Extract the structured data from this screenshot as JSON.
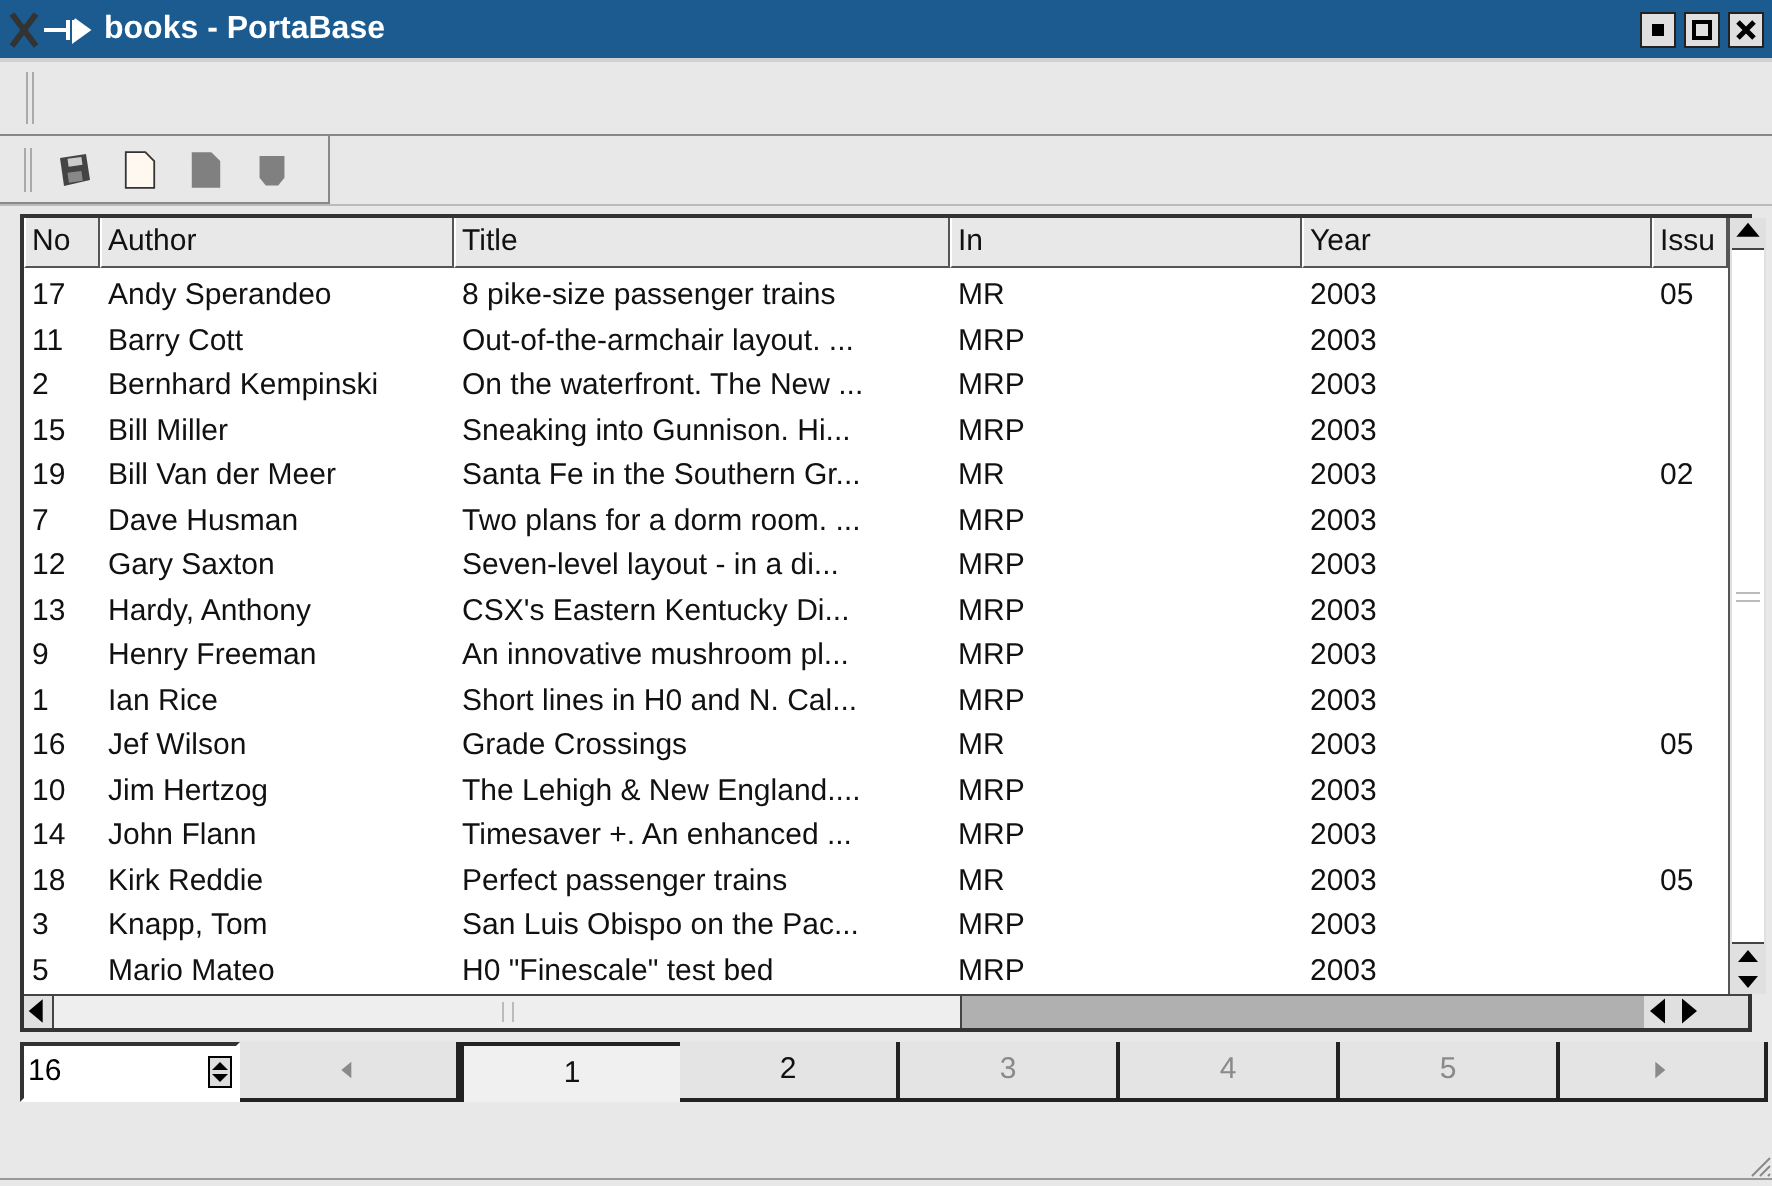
{
  "window": {
    "title": "books - PortaBase"
  },
  "table": {
    "columns": [
      "No",
      "Author",
      "Title",
      "In",
      "Year",
      "Issu"
    ],
    "rows": [
      [
        "17",
        "Andy Sperandeo",
        "8 pike-size passenger trains",
        "MR",
        "2003",
        "05"
      ],
      [
        "11",
        "Barry Cott",
        "Out-of-the-armchair layout. ...",
        "MRP",
        "2003",
        ""
      ],
      [
        "2",
        "Bernhard Kempinski",
        "On the waterfront. The New ...",
        "MRP",
        "2003",
        ""
      ],
      [
        "15",
        "Bill Miller",
        "Sneaking into Gunnison. Hi...",
        "MRP",
        "2003",
        ""
      ],
      [
        "19",
        "Bill Van der Meer",
        "Santa Fe in the Southern Gr...",
        "MR",
        "2003",
        "02"
      ],
      [
        "7",
        "Dave Husman",
        "Two plans for a dorm room. ...",
        "MRP",
        "2003",
        ""
      ],
      [
        "12",
        "Gary Saxton",
        "Seven-level layout - in a di...",
        "MRP",
        "2003",
        ""
      ],
      [
        "13",
        "Hardy, Anthony",
        "CSX's Eastern Kentucky Di...",
        "MRP",
        "2003",
        ""
      ],
      [
        "9",
        "Henry Freeman",
        "An innovative mushroom pl...",
        "MRP",
        "2003",
        ""
      ],
      [
        "1",
        "Ian Rice",
        "Short lines in H0 and N. Cal...",
        "MRP",
        "2003",
        ""
      ],
      [
        "16",
        "Jef Wilson",
        "Grade Crossings",
        "MR",
        "2003",
        "05"
      ],
      [
        "10",
        "Jim Hertzog",
        "The Lehigh & New England....",
        "MRP",
        "2003",
        ""
      ],
      [
        "14",
        "John Flann",
        "Timesaver +. An enhanced ...",
        "MRP",
        "2003",
        ""
      ],
      [
        "18",
        "Kirk Reddie",
        "Perfect passenger trains",
        "MR",
        "2003",
        "05"
      ],
      [
        "3",
        "Knapp, Tom",
        "San Luis Obispo on the Pac...",
        "MRP",
        "2003",
        ""
      ],
      [
        "5",
        "Mario Mateo",
        "H0 \"Finescale\" test bed",
        "MRP",
        "2003",
        ""
      ]
    ]
  },
  "pager": {
    "rows_per_page": "16",
    "buttons": [
      {
        "kind": "prev",
        "disabled": true,
        "selected": false
      },
      {
        "kind": "page",
        "label": "1",
        "disabled": false,
        "selected": true
      },
      {
        "kind": "page",
        "label": "2",
        "disabled": false,
        "selected": false
      },
      {
        "kind": "page",
        "label": "3",
        "disabled": true,
        "selected": false
      },
      {
        "kind": "page",
        "label": "4",
        "disabled": true,
        "selected": false
      },
      {
        "kind": "page",
        "label": "5",
        "disabled": true,
        "selected": false
      },
      {
        "kind": "next",
        "disabled": true,
        "selected": false
      }
    ]
  }
}
